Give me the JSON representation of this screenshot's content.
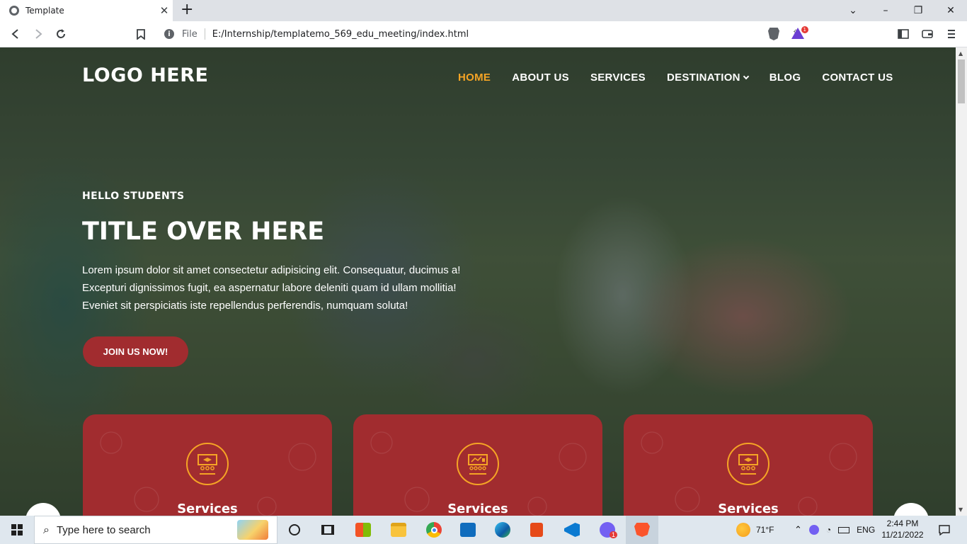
{
  "browser": {
    "tab_title": "Template",
    "tab_close": "✕",
    "new_tab": "+",
    "url_scheme": "File",
    "url": "E:/Internship/templatemo_569_edu_meeting/index.html",
    "rewards_badge": "1",
    "window_controls": [
      "⌄",
      "–",
      "❐",
      "✕"
    ]
  },
  "site": {
    "logo": "LOGO HERE",
    "nav": [
      {
        "label": "HOME",
        "active": true
      },
      {
        "label": "ABOUT US",
        "active": false
      },
      {
        "label": "SERVICES",
        "active": false
      },
      {
        "label": "DESTINATION",
        "active": false,
        "dropdown": true
      },
      {
        "label": "BLOG",
        "active": false
      },
      {
        "label": "CONTACT US",
        "active": false
      }
    ],
    "hero": {
      "eyebrow": "HELLO STUDENTS",
      "title": "TITLE OVER HERE",
      "lead_lines": [
        "Lorem ipsum dolor sit amet consectetur adipisicing elit. Consequatur, ducimus a!",
        "Excepturi dignissimos fugit, ea aspernatur labore deleniti quam id ullam mollitia!",
        "Eveniet sit perspiciatis iste repellendus perferendis, numquam soluta!"
      ],
      "cta": "JOIN US NOW!"
    },
    "cards": [
      {
        "label": "Services",
        "icon": "graduation-board-icon"
      },
      {
        "label": "Services",
        "icon": "presentation-board-icon"
      },
      {
        "label": "Services",
        "icon": "graduation-board-icon"
      }
    ],
    "colors": {
      "accent": "#f5a425",
      "card": "#a12c2f",
      "button": "#a12c2f"
    }
  },
  "taskbar": {
    "search_placeholder": "Type here to search",
    "weather": "71°F",
    "language": "ENG",
    "time": "2:44 PM",
    "date": "11/21/2022",
    "badge_count": "1"
  }
}
